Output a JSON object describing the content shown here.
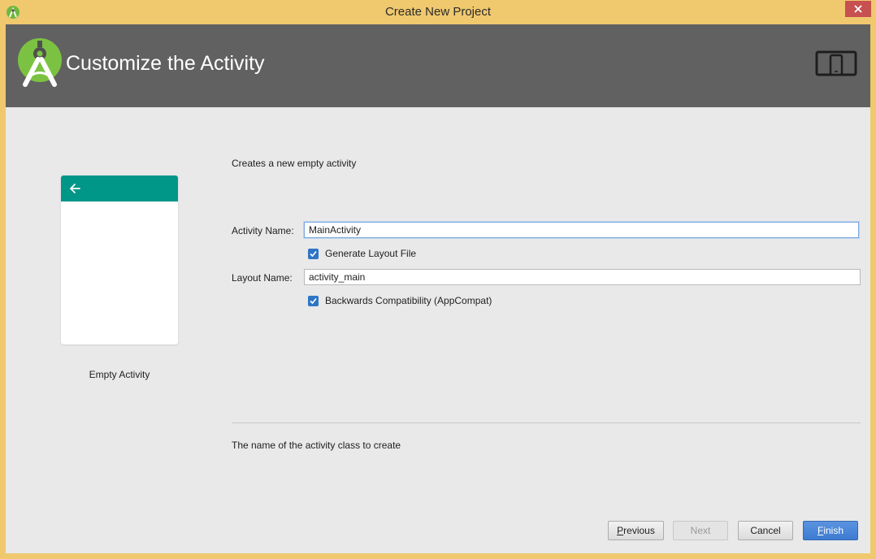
{
  "window": {
    "title": "Create New Project"
  },
  "header": {
    "title": "Customize the Activity"
  },
  "preview": {
    "caption": "Empty Activity",
    "appbar_color": "#009688"
  },
  "form": {
    "description": "Creates a new empty activity",
    "activity_name_label": "Activity Name:",
    "activity_name_value": "MainActivity",
    "generate_layout_label": "Generate Layout File",
    "generate_layout_checked": true,
    "layout_name_label": "Layout Name:",
    "layout_name_value": "activity_main",
    "backwards_compat_label": "Backwards Compatibility (AppCompat)",
    "backwards_compat_checked": true,
    "help_text": "The name of the activity class to create"
  },
  "buttons": {
    "previous_first": "P",
    "previous_rest": "revious",
    "next": "Next",
    "cancel": "Cancel",
    "finish_first": "F",
    "finish_rest": "inish"
  },
  "icons": {
    "app": "android-studio-icon",
    "logo": "android-studio-logo",
    "device": "phone-tablet-icon",
    "back": "back-arrow-icon",
    "close": "close-icon",
    "check": "checkmark-icon"
  },
  "colors": {
    "header_bg": "#616161",
    "accent": "#2f75c6",
    "frame": "#f0c86e"
  }
}
